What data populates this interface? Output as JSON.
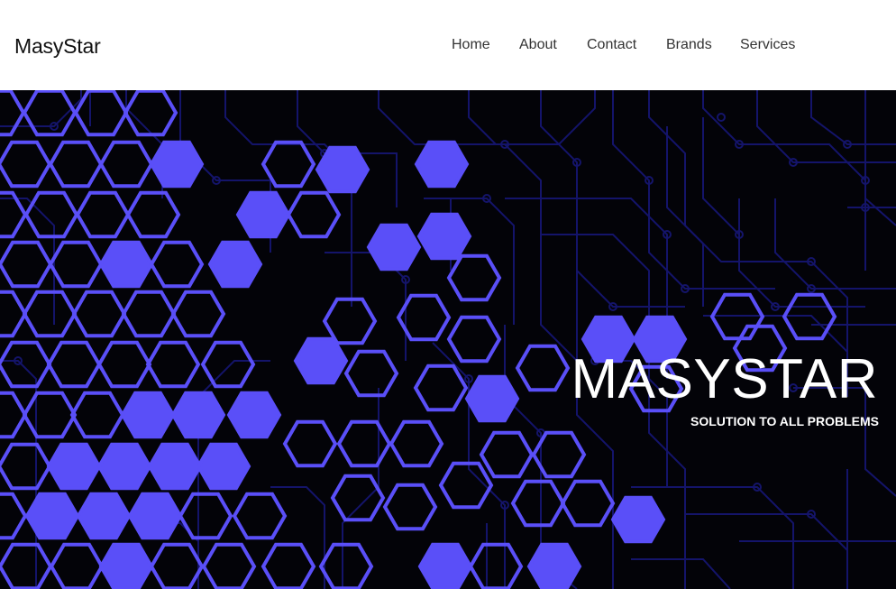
{
  "navbar": {
    "brand": "MasyStar",
    "links": [
      "Home",
      "About",
      "Contact",
      "Brands",
      "Services"
    ]
  },
  "hero": {
    "title": "MASYSTAR",
    "subtitle": "SOLUTION TO ALL PROBLEMS",
    "background_image": "circuit-board-hexagons",
    "colors": {
      "background": "#030308",
      "hexagon": "#5a4ff8",
      "circuit_trace": "#14146a",
      "text": "#ffffff"
    }
  }
}
